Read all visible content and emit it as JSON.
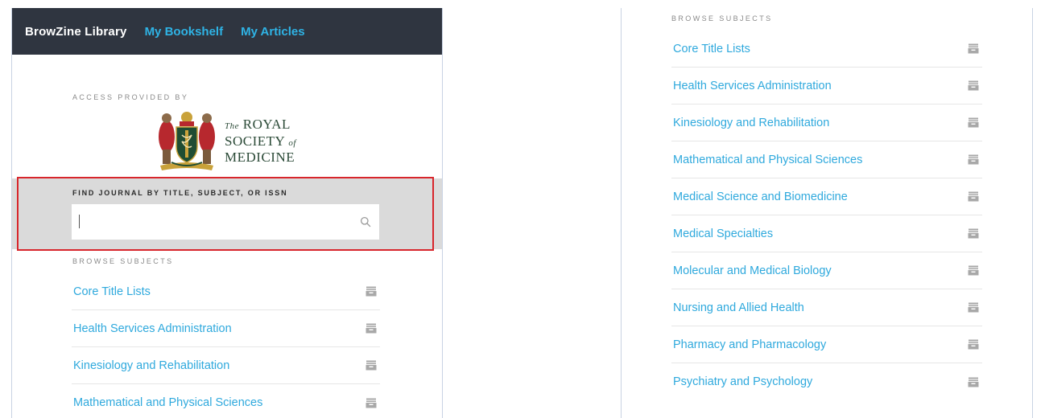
{
  "left": {
    "nav": {
      "brand": "BrowZine Library",
      "links": [
        "My Bookshelf",
        "My Articles"
      ]
    },
    "access_label": "ACCESS PROVIDED BY",
    "logo": {
      "line1_small": "The",
      "line1_big": "ROYAL",
      "line2_big": "SOCIETY",
      "line2_small": "of",
      "line3_big": "MEDICINE"
    },
    "search": {
      "label": "FIND JOURNAL BY TITLE, SUBJECT, OR ISSN",
      "value": "",
      "icon": "search-icon"
    },
    "browse_label": "BROWSE SUBJECTS",
    "subjects": [
      "Core Title Lists",
      "Health Services Administration",
      "Kinesiology and Rehabilitation",
      "Mathematical and Physical Sciences"
    ]
  },
  "right": {
    "browse_label": "BROWSE SUBJECTS",
    "subjects": [
      "Core Title Lists",
      "Health Services Administration",
      "Kinesiology and Rehabilitation",
      "Mathematical and Physical Sciences",
      "Medical Science and Biomedicine",
      "Medical Specialties",
      "Molecular and Medical Biology",
      "Nursing and Allied Health",
      "Pharmacy and Pharmacology",
      "Psychiatry and Psychology"
    ]
  },
  "colors": {
    "navbar_bg": "#2f3540",
    "nav_link": "#2fb3e5",
    "subject_link": "#2fa9dd",
    "search_band": "#dadada",
    "highlight_border": "#d8262c",
    "logo_green": "#2b4a37",
    "icon_gray": "#a8a8a8"
  },
  "icons": {
    "subject_row": "bookshelf-icon"
  }
}
